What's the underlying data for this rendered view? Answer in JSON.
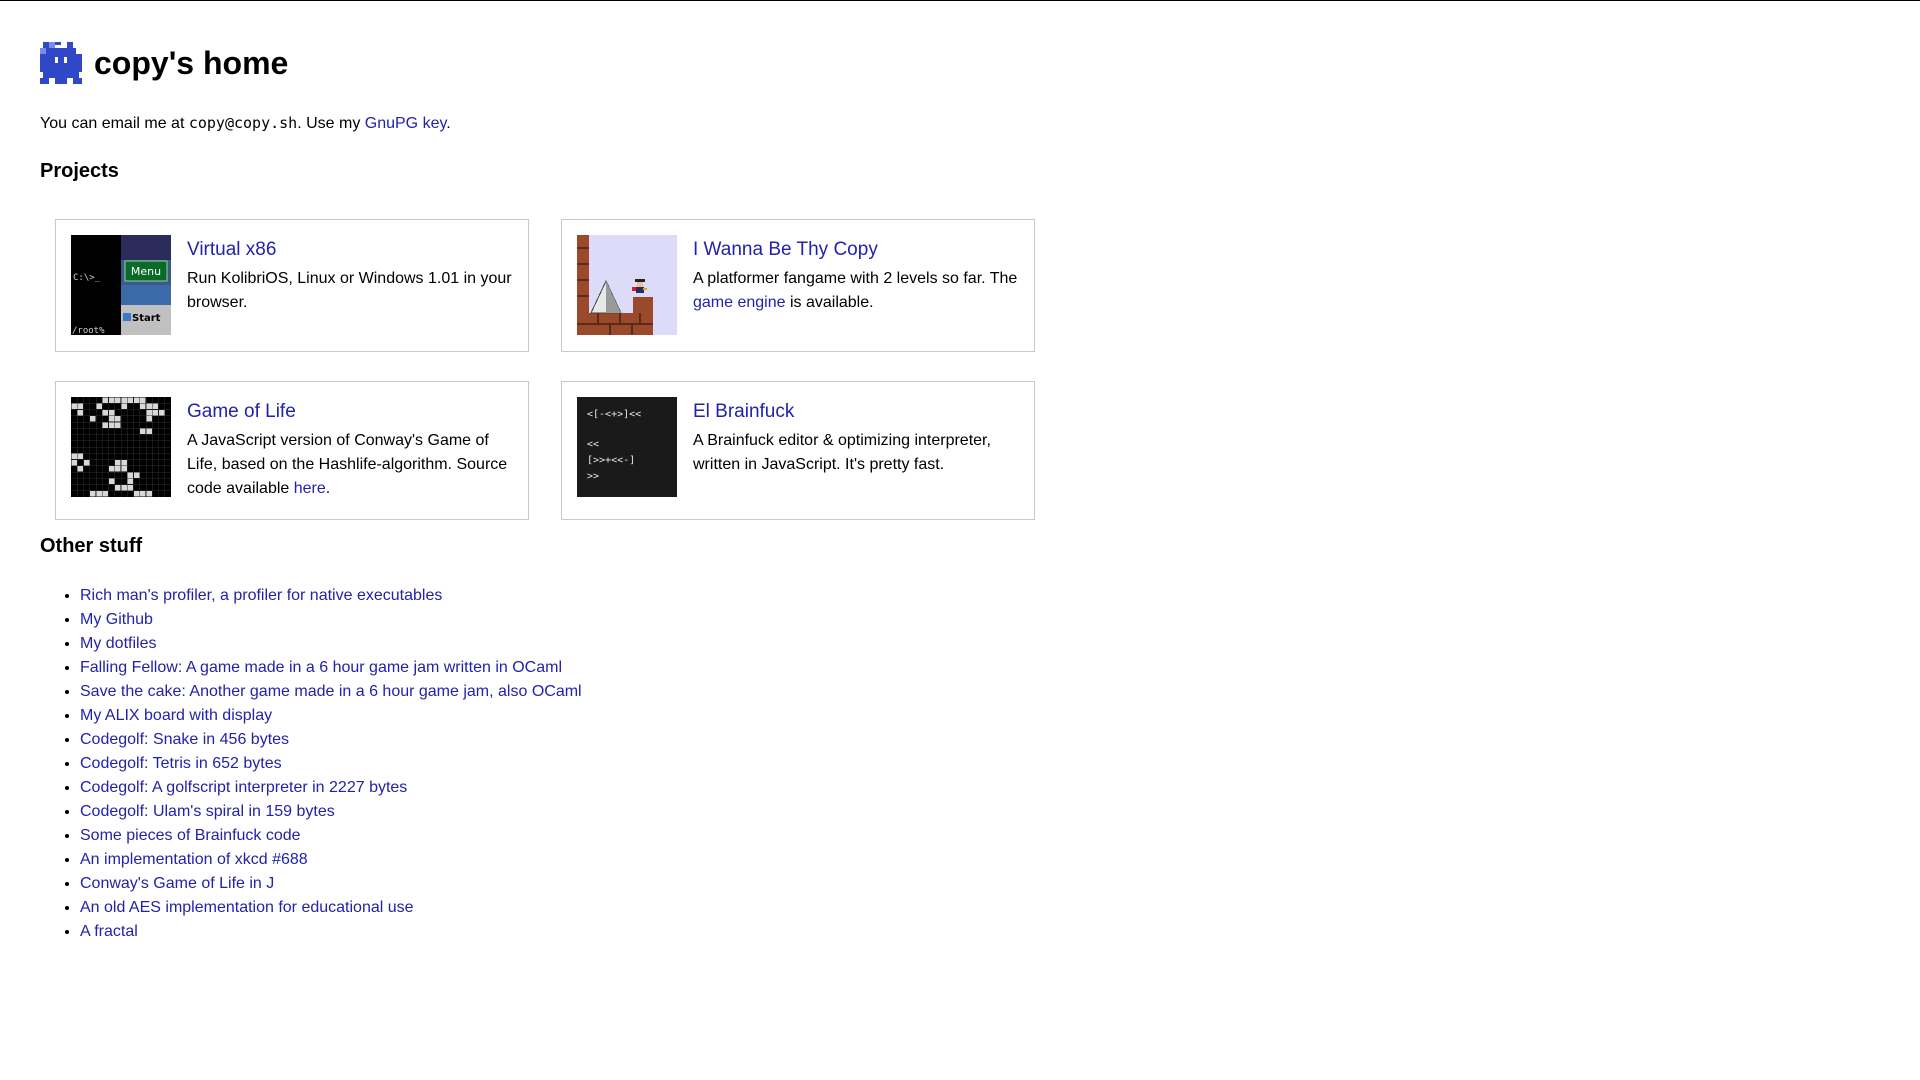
{
  "header": {
    "title": "copy's home"
  },
  "intro": {
    "prefix": "You can email me at ",
    "email": "copy@copy.sh",
    "middle": ". Use my ",
    "gnupg_link": "GnuPG key",
    "suffix": "."
  },
  "projects": {
    "heading": "Projects",
    "items": [
      {
        "title": "Virtual x86",
        "desc": "Run KolibriOS, Linux or Windows 1.01 in your browser.",
        "thumb": {
          "prompt": "C:\\>_",
          "menu": "Menu",
          "start": "Start",
          "root": "/root%"
        }
      },
      {
        "title": "I Wanna Be Thy Copy",
        "desc_prefix": "A platformer fangame with 2 levels so far. The ",
        "desc_link": "game engine",
        "desc_suffix": " is available."
      },
      {
        "title": "Game of Life",
        "desc_prefix": "A JavaScript version of Conway's Game of Life, based on the Hashlife-algorithm. Source code available ",
        "desc_link": "here",
        "desc_suffix": "."
      },
      {
        "title": "El Brainfuck",
        "desc": "A Brainfuck editor & optimizing interpreter, written in JavaScript. It's pretty fast.",
        "thumb": {
          "line1": "<[-<+>]<<",
          "line2": "<<",
          "line3": "[>>+<<-]",
          "line4": ">>"
        }
      }
    ]
  },
  "other": {
    "heading": "Other stuff",
    "links": [
      "Rich man's profiler, a profiler for native executables",
      "My Github",
      "My dotfiles",
      "Falling Fellow: A game made in a 6 hour game jam written in OCaml",
      "Save the cake: Another game made in a 6 hour game jam, also OCaml",
      "My ALIX board with display",
      "Codegolf: Snake in 456 bytes",
      "Codegolf: Tetris in 652 bytes",
      "Codegolf: A golfscript interpreter in 2227 bytes",
      "Codegolf: Ulam's spiral in 159 bytes",
      "Some pieces of Brainfuck code",
      "An implementation of xkcd #688",
      "Conway's Game of Life in J",
      "An old AES implementation for educational use",
      "A fractal"
    ]
  },
  "colors": {
    "link": "#2222aa",
    "logo": "#2a3fbf",
    "card_border": "#c8c8c8"
  },
  "icons": {
    "logo": "pixel-creature-logo-icon"
  }
}
